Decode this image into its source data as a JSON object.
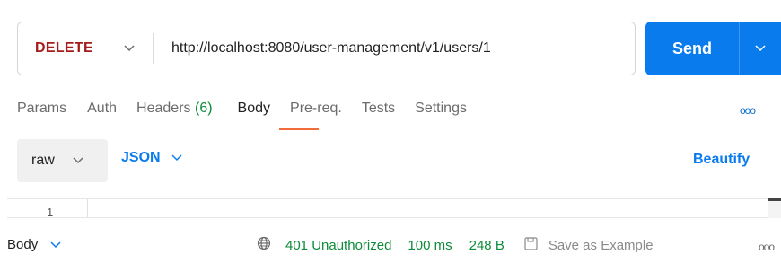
{
  "request": {
    "method": "DELETE",
    "url": "http://localhost:8080/user-management/v1/users/1",
    "send_label": "Send"
  },
  "tabs": [
    {
      "label": "Params"
    },
    {
      "label": "Auth"
    },
    {
      "label": "Headers",
      "count": "(6)"
    },
    {
      "label": "Body",
      "active": true
    },
    {
      "label": "Pre-req."
    },
    {
      "label": "Tests"
    },
    {
      "label": "Settings"
    }
  ],
  "tabs_more": "ooo",
  "body_mode": {
    "mode": "raw",
    "language": "JSON",
    "beautify_label": "Beautify"
  },
  "editor": {
    "line_numbers": [
      "1"
    ]
  },
  "response": {
    "section_label": "Body",
    "status": "401 Unauthorized",
    "time": "100 ms",
    "size": "248 B",
    "save_example_label": "Save as Example",
    "more": "ooo"
  },
  "colors": {
    "method": "#a61c1c",
    "send_bg": "#097bed",
    "accent_blue": "#097bed",
    "tab_active_underline": "#f26b3a",
    "status_green": "#0c8b3a"
  },
  "icons": {
    "method_chevron": "chevron-down-icon",
    "send_chevron": "chevron-down-icon",
    "globe": "globe-icon",
    "save": "save-icon"
  }
}
